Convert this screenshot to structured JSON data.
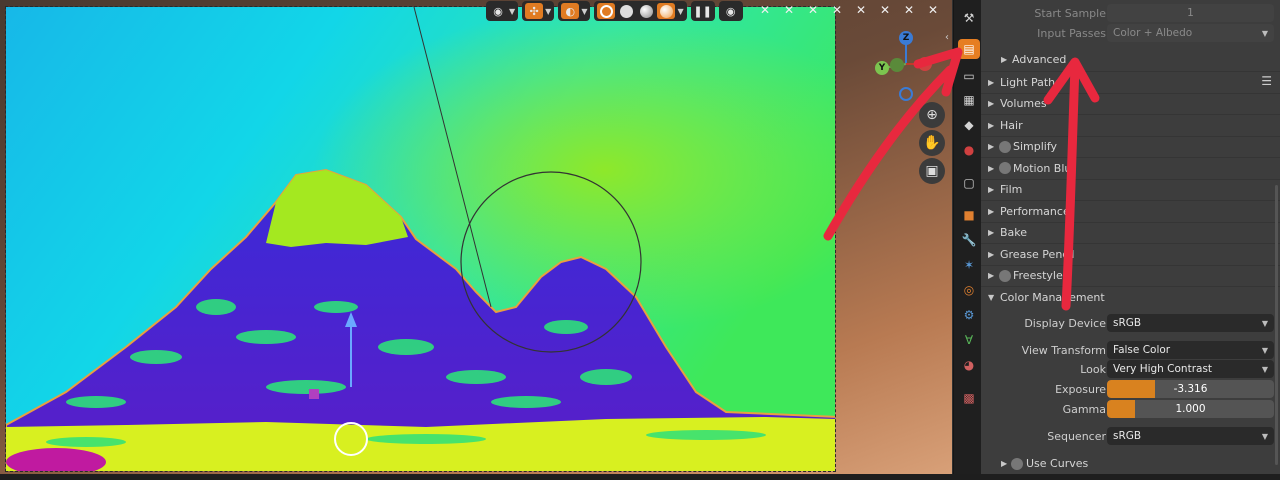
{
  "viewport": {
    "header_icons": [
      "visibility-icon",
      "gizmo-icon",
      "overlay-icon",
      "shading-wireframe",
      "shading-solid",
      "shading-material",
      "shading-rendered",
      "pause-icon",
      "eye-icon"
    ],
    "colors": {
      "sky_cyan": "#12d6e8",
      "sky_green": "#3ee85a",
      "mountain_blue": "#2430d8",
      "peak_yellowgreen": "#a4e820",
      "ground_yellow": "#d8f020",
      "accent_orange": "#e67e22"
    }
  },
  "gizmo": {
    "z": "Z",
    "y": "Y"
  },
  "properties": {
    "start_sample": {
      "label": "Start Sample",
      "value": "1"
    },
    "input_passes": {
      "label": "Input Passes",
      "value": "Color + Albedo"
    },
    "advanced": "Advanced",
    "sections": [
      {
        "label": "Light Paths",
        "has_checkbox": false
      },
      {
        "label": "Volumes",
        "has_checkbox": false
      },
      {
        "label": "Hair",
        "has_checkbox": false
      },
      {
        "label": "Simplify",
        "has_checkbox": true
      },
      {
        "label": "Motion Blur",
        "has_checkbox": true
      },
      {
        "label": "Film",
        "has_checkbox": false
      },
      {
        "label": "Performance",
        "has_checkbox": false
      },
      {
        "label": "Bake",
        "has_checkbox": false
      },
      {
        "label": "Grease Pencil",
        "has_checkbox": false
      },
      {
        "label": "Freestyle",
        "has_checkbox": true
      }
    ],
    "color_management": {
      "label": "Color Management",
      "display_device": {
        "label": "Display Device",
        "value": "sRGB"
      },
      "view_transform": {
        "label": "View Transform",
        "value": "False Color"
      },
      "look": {
        "label": "Look",
        "value": "Very High Contrast"
      },
      "exposure": {
        "label": "Exposure",
        "value": "-3.316",
        "fill": 0.29
      },
      "gamma": {
        "label": "Gamma",
        "value": "1.000",
        "fill": 0.17
      },
      "sequencer": {
        "label": "Sequencer",
        "value": "sRGB"
      },
      "use_curves": "Use Curves"
    }
  }
}
